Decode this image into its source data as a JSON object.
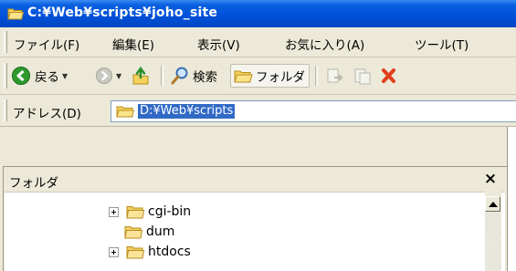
{
  "window": {
    "title": "C:¥Web¥scripts¥joho_site"
  },
  "menu": {
    "items": [
      "ファイル(F)",
      "編集(E)",
      "表示(V)",
      "お気に入り(A)",
      "ツール(T)"
    ]
  },
  "toolbar": {
    "back_label": "戻る",
    "search_label": "検索",
    "folders_label": "フォルダ"
  },
  "address": {
    "label": "アドレス(D)",
    "value": "D:¥Web¥scripts"
  },
  "folder_pane": {
    "title": "フォルダ",
    "close_label": "×",
    "items": [
      {
        "label": "cgi-bin",
        "expandable": true
      },
      {
        "label": "dum",
        "expandable": false
      },
      {
        "label": "htdocs",
        "expandable": true
      }
    ]
  },
  "colors": {
    "titlebar": "#0050d8",
    "address_highlight": "#316ac5"
  }
}
